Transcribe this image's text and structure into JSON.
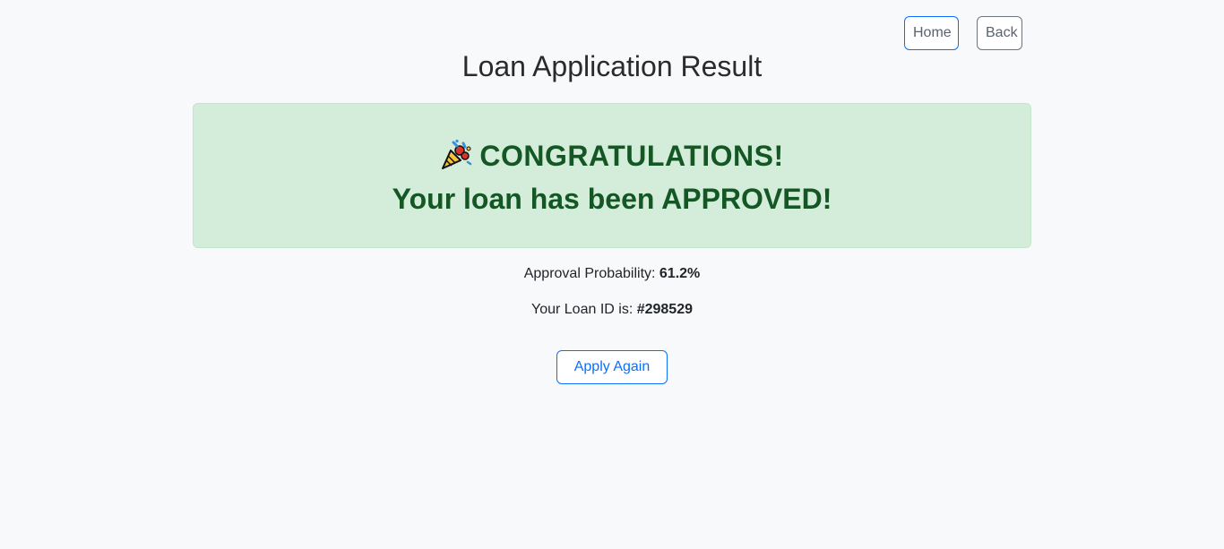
{
  "nav": {
    "home_label": "Home",
    "back_label": "Back"
  },
  "page": {
    "title": "Loan Application Result"
  },
  "result": {
    "icon": "party-popper-icon",
    "headline": "CONGRATULATIONS!",
    "message_prefix": "Your loan has been ",
    "message_status": "APPROVED",
    "message_suffix": "!",
    "status_color": "#155724",
    "background_color": "#d4edda"
  },
  "details": {
    "probability_label": "Approval Probability: ",
    "probability_value": "61.2%",
    "loan_id_label": "Your Loan ID is: ",
    "loan_id_value": "#298529"
  },
  "actions": {
    "apply_again_label": "Apply Again"
  }
}
